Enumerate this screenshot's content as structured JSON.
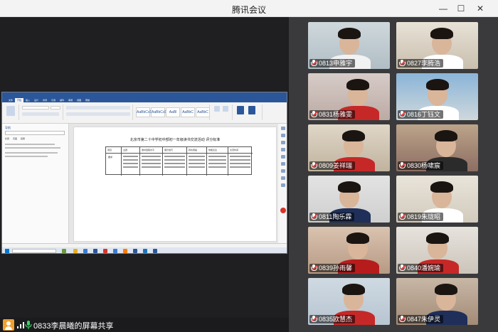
{
  "window": {
    "title": "腾讯会议",
    "minimize_glyph": "—",
    "maximize_glyph": "☐",
    "close_glyph": "✕"
  },
  "shared_document": {
    "tabs": [
      "文件",
      "开始",
      "插入",
      "设计",
      "布局",
      "引用",
      "邮件",
      "审阅",
      "视图",
      "帮助"
    ],
    "active_tab_index": 1,
    "style_samples": [
      "AaBbCcDd",
      "AaBbCcDd",
      "AaBl",
      "AaBbC",
      "AaBbC"
    ],
    "nav_title": "导航",
    "nav_tabs": [
      "标题",
      "页面",
      "结果"
    ],
    "page_heading": "北京市第二十中学初中部初一年级读书交流活动 评分标准",
    "table_headers": [
      "项目",
      "主题",
      "素材选取水平",
      "展示技巧",
      "聆听者提",
      "效能表达",
      "交流时间"
    ],
    "table_row_label": "要求"
  },
  "bottom_bar": {
    "sharer_text": "0833李晨曦的屏幕共享"
  },
  "participants": [
    {
      "name": "0813申雅宇",
      "muted": true
    },
    {
      "name": "0827李腾浩",
      "muted": true
    },
    {
      "name": "0831杨雅雯",
      "muted": true
    },
    {
      "name": "0816丁钰文",
      "muted": true
    },
    {
      "name": "0809姜祥瑞",
      "muted": true
    },
    {
      "name": "0830杨啸宸",
      "muted": true
    },
    {
      "name": "0811陶乐霖",
      "muted": true
    },
    {
      "name": "0819朱珑昭",
      "muted": true
    },
    {
      "name": "0839孙雨馨",
      "muted": true
    },
    {
      "name": "0840潘婉瑜",
      "muted": true
    },
    {
      "name": "0835欧慧杰",
      "muted": true
    },
    {
      "name": "0847朱伊灵",
      "muted": true
    }
  ],
  "colors": {
    "word_blue": "#2b579a",
    "meeting_orange": "#f0a030",
    "muted_red": "#f04040"
  }
}
